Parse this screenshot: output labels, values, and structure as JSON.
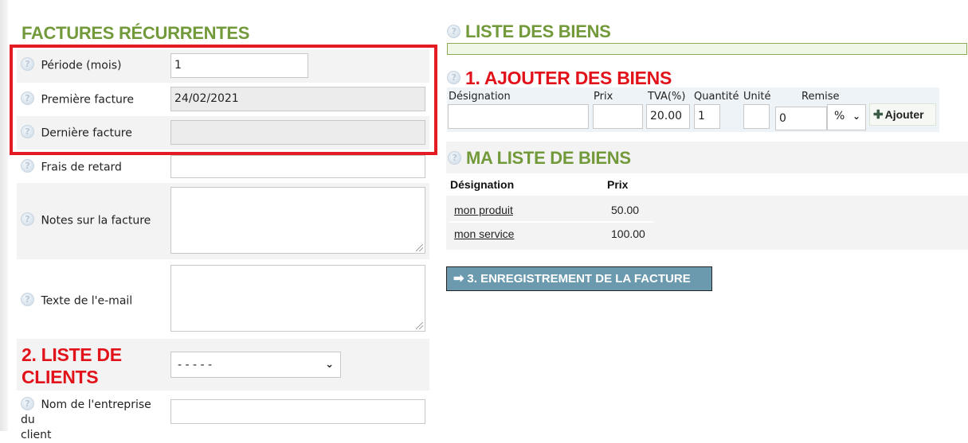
{
  "left": {
    "title": "FACTURES RÉCURRENTES",
    "fields": {
      "period": {
        "label": "Période (mois)",
        "value": "1"
      },
      "first_invoice": {
        "label": "Première facture",
        "value": "24/02/2021"
      },
      "last_invoice": {
        "label": "Dernière facture",
        "value": ""
      },
      "late_fees": {
        "label": "Frais de retard",
        "value": ""
      },
      "invoice_notes": {
        "label": "Notes sur la facture",
        "value": ""
      },
      "email_text": {
        "label": "Texte de l'e-mail",
        "value": ""
      }
    },
    "clients": {
      "title_line1": "2. LISTE DE",
      "title_line2": "CLIENTS",
      "selected": "- - - - -"
    },
    "client_company": {
      "label": "Nom de l'entreprise du",
      "label_line2": "client",
      "value": ""
    },
    "help_icon": "?"
  },
  "right": {
    "liste_title": "LISTE DES BIENS",
    "add_title": "1. AJOUTER DES BIENS",
    "add_form": {
      "headers": {
        "designation": "Désignation",
        "price": "Prix",
        "vat": "TVA(%)",
        "quantity": "Quantité",
        "unit": "Unité",
        "discount": "Remise"
      },
      "values": {
        "designation": "",
        "price": "",
        "vat": "20.00",
        "quantity": "1",
        "unit": "",
        "discount": "0",
        "discount_type": "%"
      },
      "add_button": "Ajouter",
      "add_icon": "✚"
    },
    "my_list": {
      "title": "MA LISTE DE BIENS",
      "columns": [
        "Désignation",
        "Prix"
      ],
      "rows": [
        {
          "name": "mon produit",
          "price": "50.00"
        },
        {
          "name": "mon service",
          "price": "100.00"
        }
      ]
    },
    "save_button": "3. ENREGISTREMENT DE LA FACTURE",
    "save_icon": "➡"
  },
  "colors": {
    "green_title": "#72993a",
    "red_title": "#e2121b",
    "highlight_border": "#e31b23",
    "save_button_bg": "#6b9aae"
  }
}
